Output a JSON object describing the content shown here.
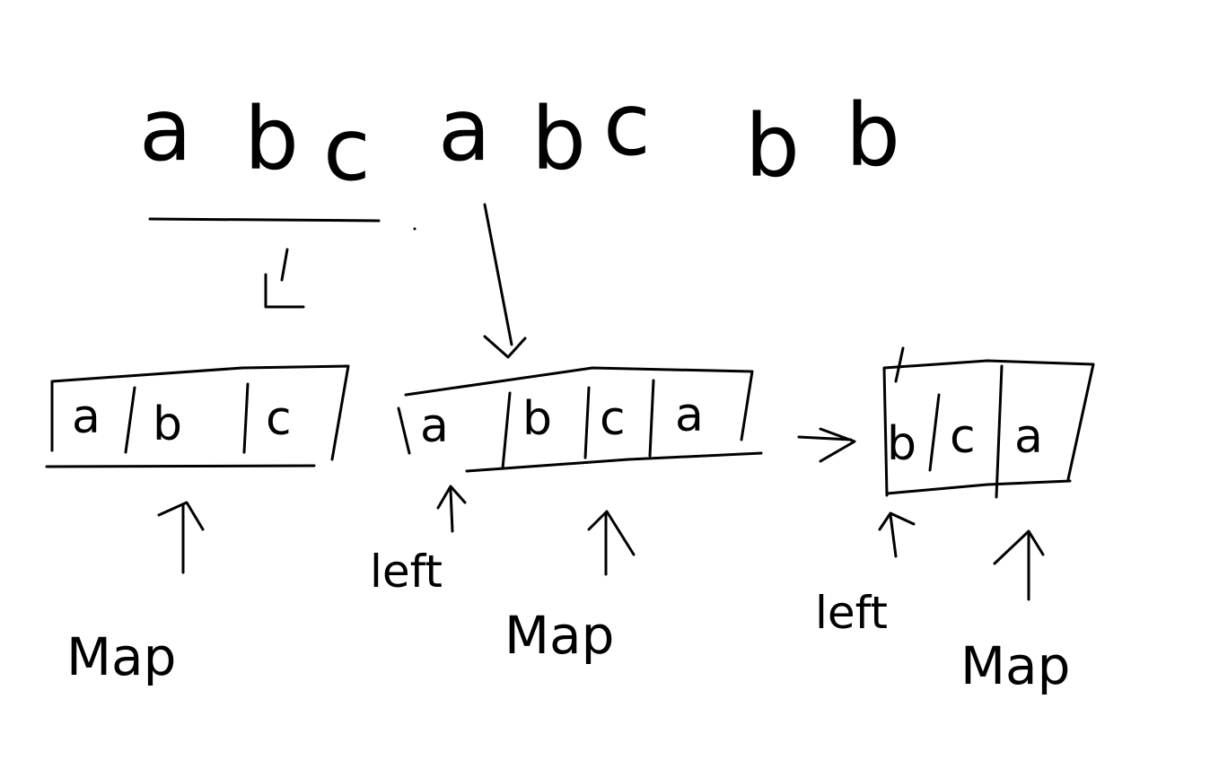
{
  "string": [
    "a",
    "b",
    "c",
    "a",
    "b",
    "c",
    "b",
    "b"
  ],
  "window_1": {
    "cells": [
      "a",
      "b",
      "c"
    ],
    "label": "Map"
  },
  "window_2": {
    "cells": [
      "a",
      "b",
      "c",
      "a"
    ],
    "left_label": "left",
    "label": "Map"
  },
  "window_3": {
    "cells": [
      "b",
      "c",
      "a"
    ],
    "left_label": "left",
    "label": "Map"
  },
  "ink_color": "#000000",
  "background_color": "#ffffff"
}
